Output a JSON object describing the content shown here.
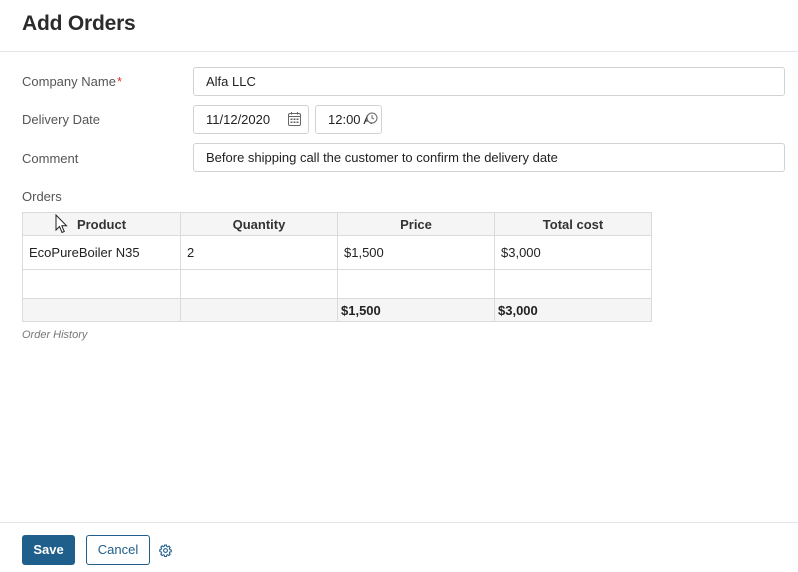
{
  "header": {
    "title": "Add Orders"
  },
  "form": {
    "company": {
      "label": "Company Name",
      "required_mark": "*",
      "value": "Alfa LLC"
    },
    "delivery": {
      "label": "Delivery Date",
      "date_value": "11/12/2020",
      "time_value": "12:00 A"
    },
    "comment": {
      "label": "Comment",
      "value": "Before shipping call the customer to confirm the delivery date"
    },
    "orders_label": "Orders"
  },
  "orders_table": {
    "columns": [
      "Product",
      "Quantity",
      "Price",
      "Total cost"
    ],
    "rows": [
      {
        "product": "EcoPureBoiler N35",
        "quantity": "2",
        "price": "$1,500",
        "total": "$3,000"
      }
    ],
    "totals": {
      "price": "$1,500",
      "total": "$3,000"
    }
  },
  "order_history_label": "Order History",
  "footer": {
    "save_label": "Save",
    "cancel_label": "Cancel"
  },
  "icons": {
    "date": "calendar-icon",
    "time": "clock-icon",
    "settings": "gear-icon"
  },
  "colors": {
    "primary": "#1f5f8b",
    "required": "#d9322e",
    "border": "#cfd3d6"
  }
}
